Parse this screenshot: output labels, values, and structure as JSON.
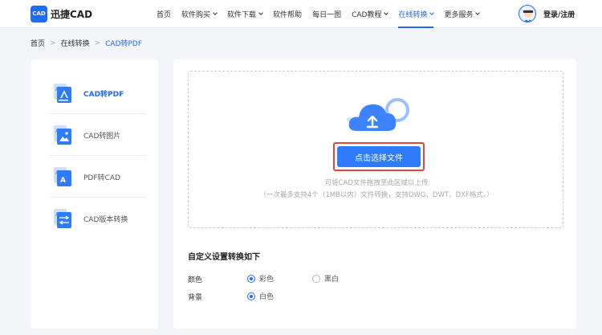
{
  "header": {
    "logo_text": "CAD",
    "brand": "迅捷CAD",
    "nav": [
      {
        "label": "首页",
        "dropdown": false,
        "active": false
      },
      {
        "label": "软件购买",
        "dropdown": true,
        "active": false
      },
      {
        "label": "软件下载",
        "dropdown": true,
        "active": false
      },
      {
        "label": "软件帮助",
        "dropdown": false,
        "active": false
      },
      {
        "label": "每日一图",
        "dropdown": false,
        "active": false
      },
      {
        "label": "CAD教程",
        "dropdown": true,
        "active": false
      },
      {
        "label": "在线转换",
        "dropdown": true,
        "active": true
      },
      {
        "label": "更多服务",
        "dropdown": true,
        "active": false
      }
    ],
    "login": "登录/注册"
  },
  "breadcrumb": {
    "items": [
      "首页",
      "在线转换",
      "CAD转PDF"
    ],
    "separator": ">"
  },
  "sidebar": {
    "items": [
      {
        "label": "CAD转PDF",
        "icon": "cad-to-pdf-icon",
        "active": true
      },
      {
        "label": "CAD转图片",
        "icon": "cad-to-image-icon",
        "active": false
      },
      {
        "label": "PDF转CAD",
        "icon": "pdf-to-cad-icon",
        "active": false
      },
      {
        "label": "CAD版本转换",
        "icon": "cad-version-convert-icon",
        "active": false
      }
    ]
  },
  "upload": {
    "icon": "cloud-upload-icon",
    "button_label": "点击选择文件",
    "hint1": "可将CAD文件拖拽至此区域以上传",
    "hint2": "（一次最多支持4个（1MB以内）文件转换，支持DWG、DWT、DXF格式。）"
  },
  "settings": {
    "title": "自定义设置转换如下",
    "color_label": "颜色",
    "color_options": [
      {
        "label": "彩色",
        "checked": true
      },
      {
        "label": "黑白",
        "checked": false
      }
    ],
    "background_label": "背景",
    "background_options": [
      {
        "label": "白色",
        "checked": true
      }
    ]
  },
  "colors": {
    "accent": "#1f6bff",
    "button": "#2f7bff",
    "highlight_border": "#e0473a",
    "page_bg": "#f3f5f8"
  }
}
